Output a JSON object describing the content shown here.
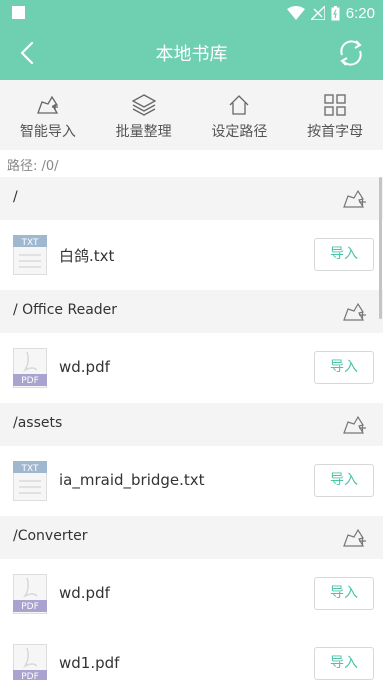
{
  "status_bar": {
    "time": "6:20"
  },
  "header": {
    "title": "本地书库"
  },
  "toolbar": {
    "items": [
      {
        "label": "智能导入",
        "icon": "smart-import-icon"
      },
      {
        "label": "批量整理",
        "icon": "layers-icon"
      },
      {
        "label": "设定路径",
        "icon": "home-icon"
      },
      {
        "label": "按首字母",
        "icon": "grid-icon"
      }
    ]
  },
  "path": {
    "text": "路径: /0/"
  },
  "groups": [
    {
      "folder": "/",
      "file": "白鸽.txt",
      "type": "TXT"
    },
    {
      "folder": "/ Office Reader",
      "file": "wd.pdf",
      "type": "PDF"
    },
    {
      "folder": "/assets",
      "file": "ia_mraid_bridge.txt",
      "type": "TXT"
    },
    {
      "folder": "/Converter",
      "file": "wd.pdf",
      "type": "PDF"
    },
    {
      "folder": "",
      "file": "wd1.pdf",
      "type": "PDF"
    }
  ],
  "import_label": "导入",
  "colors": {
    "accent": "#6fcfb1",
    "button_text": "#4ec3a8"
  }
}
